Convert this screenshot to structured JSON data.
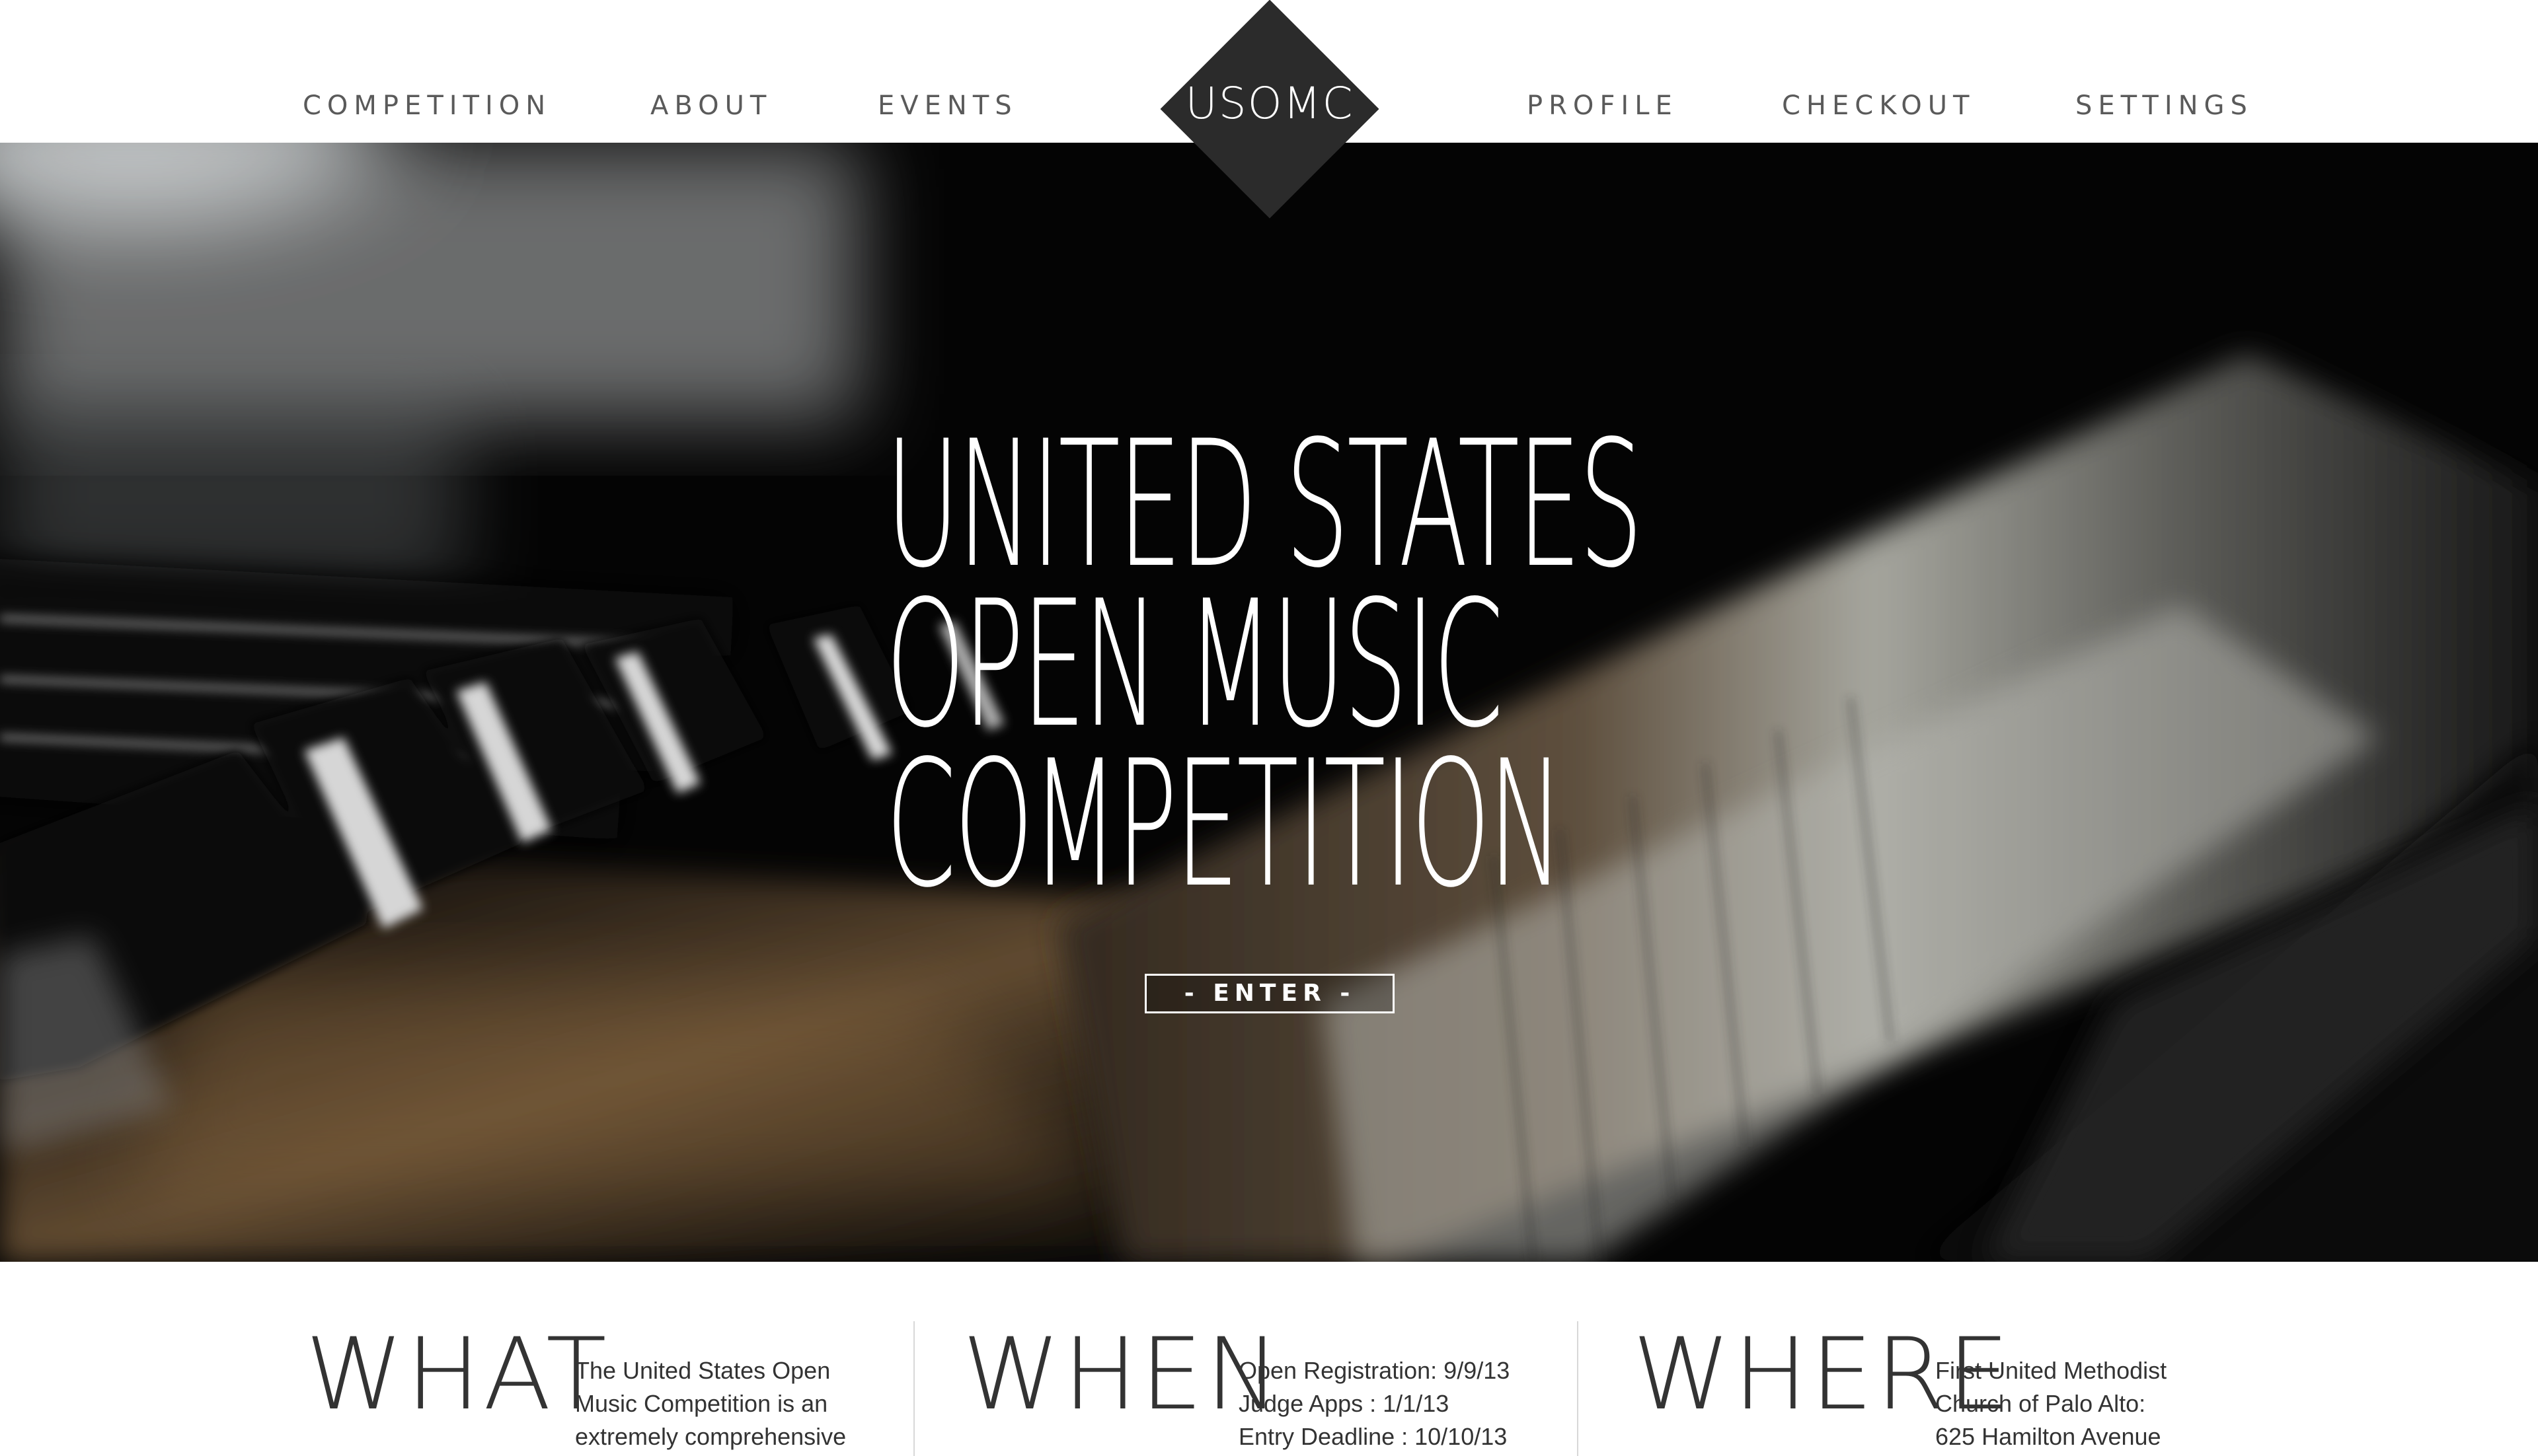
{
  "nav": {
    "left_items": [
      {
        "label": "COMPETITION"
      },
      {
        "label": "ABOUT"
      },
      {
        "label": "EVENTS"
      }
    ],
    "logo": "USOMC",
    "right_items": [
      {
        "label": "PROFILE"
      },
      {
        "label": "CHECKOUT"
      },
      {
        "label": "SETTINGS"
      }
    ]
  },
  "hero": {
    "title_lines": [
      "UNITED STATES",
      "OPEN MUSIC",
      "COMPETITION"
    ],
    "enter_label": "- ENTER -",
    "background": "piano-keys-photo"
  },
  "info": {
    "what": {
      "heading": "WHAT",
      "lines": [
        "The United States Open",
        "Music Competition is an",
        "extremely comprehensive"
      ]
    },
    "when": {
      "heading": "WHEN",
      "lines": [
        "Open Registration: 9/9/13",
        "Judge Apps : 1/1/13",
        "Entry Deadline : 10/10/13"
      ]
    },
    "where": {
      "heading": "WHERE",
      "lines": [
        "First United Methodist",
        "Church of Palo Alto:",
        "625 Hamilton Avenue"
      ]
    }
  },
  "colors": {
    "logo_bg": "#2b2b2b",
    "nav_text": "#5a5a5a",
    "hero_bg": "#070707",
    "text": "#333333"
  }
}
